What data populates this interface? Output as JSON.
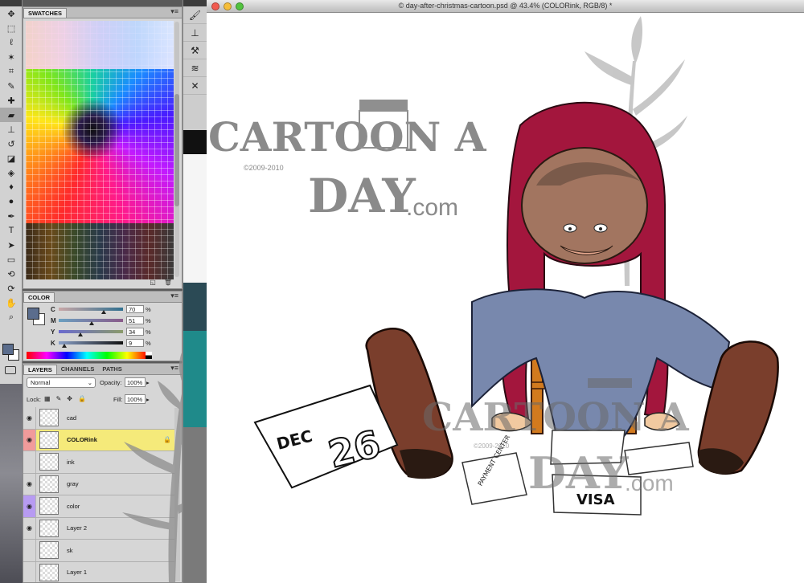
{
  "document": {
    "title": "© day-after-christmas-cartoon.psd @ 43.4% (COLORink, RGB/8) *"
  },
  "tools": [
    "move-tool",
    "marquee-tool",
    "lasso-tool",
    "magic-wand-tool",
    "crop-tool",
    "eyedropper-tool",
    "healing-tool",
    "brush-tool",
    "stamp-tool",
    "history-brush-tool",
    "eraser-tool",
    "gradient-tool",
    "blur-tool",
    "dodge-tool",
    "pen-tool",
    "type-tool",
    "path-select-tool",
    "shape-tool",
    "3d-rotate-tool",
    "3d-orbit-tool",
    "hand-tool",
    "zoom-tool"
  ],
  "swatches_panel": {
    "tab": "SWATCHES"
  },
  "color_panel": {
    "tab": "COLOR",
    "fg_color": "#5b6d8d",
    "bg_color": "#ffffff",
    "channels": [
      {
        "label": "C",
        "value": "70",
        "unit": "%",
        "level": 0.7
      },
      {
        "label": "M",
        "value": "51",
        "unit": "%",
        "level": 0.51
      },
      {
        "label": "Y",
        "value": "34",
        "unit": "%",
        "level": 0.34
      },
      {
        "label": "K",
        "value": "9",
        "unit": "%",
        "level": 0.09
      }
    ]
  },
  "layers_panel": {
    "tabs": [
      "LAYERS",
      "CHANNELS",
      "PATHS"
    ],
    "blend_mode": "Normal",
    "opacity_label": "Opacity:",
    "opacity": "100%",
    "lock_label": "Lock:",
    "fill_label": "Fill:",
    "fill": "100%",
    "layers": [
      {
        "name": "cad",
        "visible": true,
        "selected": false,
        "color": ""
      },
      {
        "name": "COLORink",
        "visible": true,
        "selected": true,
        "color": "red"
      },
      {
        "name": "ink",
        "visible": false,
        "selected": false,
        "color": ""
      },
      {
        "name": "gray",
        "visible": true,
        "selected": false,
        "color": ""
      },
      {
        "name": "color",
        "visible": true,
        "selected": false,
        "color": "purple"
      },
      {
        "name": "Layer 2",
        "visible": true,
        "selected": false,
        "color": ""
      },
      {
        "name": "sk",
        "visible": false,
        "selected": false,
        "color": ""
      },
      {
        "name": "Layer 1",
        "visible": false,
        "selected": false,
        "color": ""
      }
    ]
  },
  "artwork": {
    "logo_line1": "CARTOON A",
    "logo_line2": "DAY",
    "logo_suffix": ".com",
    "copyright": "©2009-2010",
    "calendar_month": "DEC",
    "calendar_day": "26",
    "paper_visa": "VISA",
    "paper_notice": "PAYMENT CENTER"
  }
}
